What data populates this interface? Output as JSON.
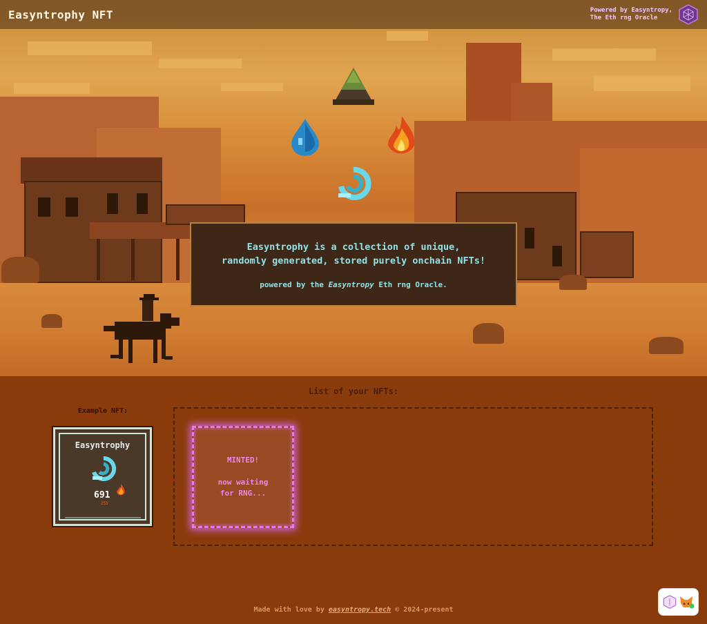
{
  "header": {
    "brand": "Easyntrophy NFT",
    "powered_line1": "Powered by Easyntropy,",
    "powered_line2": "The Eth rng Oracle",
    "logo_icon": "hex-cube-logo-icon"
  },
  "hero": {
    "elements": [
      "earth-icon",
      "water-icon",
      "fire-icon",
      "air-icon"
    ],
    "panel": {
      "line1": "Easyntrophy is a collection of unique,",
      "line2": "randomly generated, stored purely onchain NFTs!",
      "sub_prefix": "powered by the ",
      "sub_em": "Easyntropy",
      "sub_suffix": " Eth rng Oracle."
    }
  },
  "nfts": {
    "list_title": "List of your NFTs:",
    "example_label": "Example NFT:",
    "example": {
      "name": "Easyntrophy",
      "number": "691",
      "small": "255",
      "element_icon": "air-icon",
      "badge_icon": "fire-icon"
    },
    "minted": {
      "title": "MINTED!",
      "wait_line1": "now waiting",
      "wait_line2": "for RNG..."
    }
  },
  "footer": {
    "prefix": "Made with love by ",
    "link": "easyntropy.tech",
    "suffix": " © 2024-present"
  },
  "colors": {
    "background": "#8a3b0c",
    "panel_text": "#8fe3e8",
    "minted_glow": "#e878e8"
  }
}
